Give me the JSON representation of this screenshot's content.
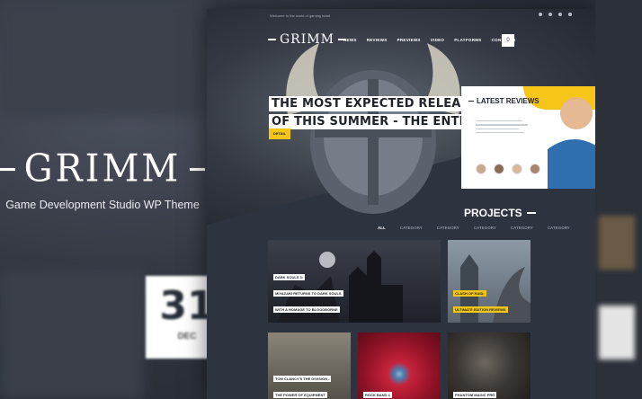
{
  "brand": {
    "title": "GRIMM",
    "subtitle": "Game Development Studio WP Theme"
  },
  "date_badge": {
    "day": "31",
    "month": "DEC"
  },
  "site": {
    "topbar_text": "Welcome to the world of gaming heart",
    "logo": "GRIMM",
    "menu": [
      "NEWS",
      "REVIEWS",
      "PREVIEWS",
      "VIDEO",
      "PLATFORMS",
      "CONTACTS"
    ],
    "cart_label": "0",
    "hero": {
      "headline_line1": "THE MOST EXPECTED RELEASE",
      "headline_line2": "OF THIS SUMMER - THE ENTITY!",
      "button": "DETAIL"
    },
    "reviews": {
      "title": "LATEST REVIEWS"
    },
    "projects": {
      "title": "PROJECTS",
      "filters": [
        "ALL",
        "CATEGORY",
        "CATEGORY",
        "CATEGORY",
        "CATEGORY",
        "CATEGORY"
      ],
      "items": [
        {
          "line1": "DARK SOULS 3:",
          "line2": "MIYAZAKI RETURNS TO DARK SOULS",
          "line3": "WITH A HOMAGE TO BLOODBORNE"
        },
        {
          "line1": "CLASH OF RAID:",
          "line2": "ULTIMATE EDITION REVIEWS"
        },
        {
          "line1": "TOM CLANCY'S THE DIVISION -",
          "line2": "THE POWER OF EQUIPMENT"
        },
        {
          "line1": "ROCK BAND 4"
        },
        {
          "line1": "PHANTOM MAGIC PRO"
        }
      ]
    }
  },
  "colors": {
    "accent": "#f5c518",
    "dark": "#2e3340"
  }
}
